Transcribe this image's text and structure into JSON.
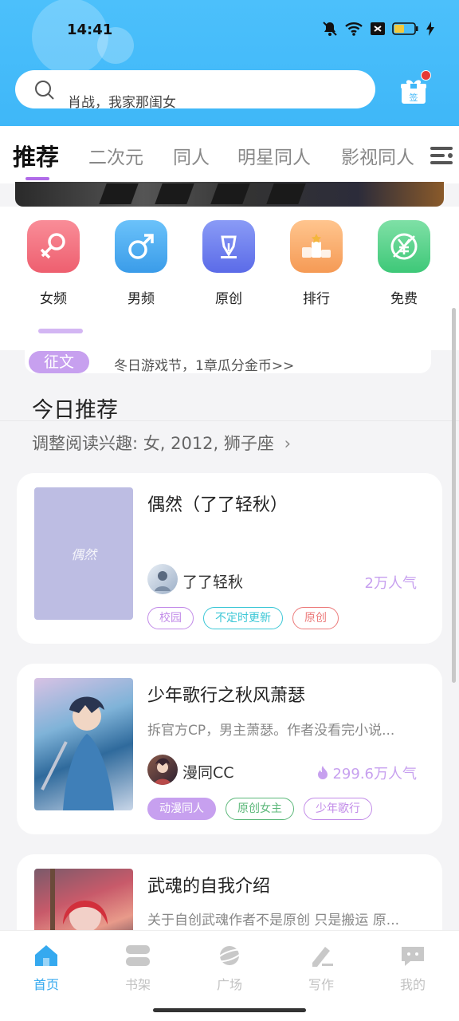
{
  "status_bar": {
    "time": "14:41"
  },
  "search": {
    "placeholder_text": "肖战，我家那闺女"
  },
  "gift": {
    "label": "签"
  },
  "tabs": [
    {
      "label": "推荐",
      "active": true
    },
    {
      "label": "二次元"
    },
    {
      "label": "同人"
    },
    {
      "label": "明星同人"
    },
    {
      "label": "影视同人"
    }
  ],
  "categories": [
    {
      "label": "女频",
      "icon": "female-icon",
      "color": "#f06a78"
    },
    {
      "label": "男频",
      "icon": "male-icon",
      "color": "#42a9f0"
    },
    {
      "label": "原创",
      "icon": "pen-nib-icon",
      "color": "#6b7ff0"
    },
    {
      "label": "排行",
      "icon": "ranking-icon",
      "color": "#f5a060"
    },
    {
      "label": "免费",
      "icon": "yuan-icon",
      "color": "#48cf7e"
    }
  ],
  "notice": {
    "tag": "征文",
    "text": "冬日游戏节，1章瓜分金币>>"
  },
  "section": {
    "title": "今日推荐",
    "subtitle": "调整阅读兴趣: 女, 2012, 狮子座"
  },
  "books": [
    {
      "title": "偶然（了了轻秋）",
      "cover_text": "偶然",
      "author": "了了轻秋",
      "popularity": "2万人气",
      "tags": [
        {
          "label": "校园",
          "color": "#c28be8"
        },
        {
          "label": "不定时更新",
          "color": "#3cc7d6"
        },
        {
          "label": "原创",
          "color": "#ec7b7b"
        }
      ]
    },
    {
      "title": "少年歌行之秋风萧瑟",
      "desc": "拆官方CP，男主萧瑟。作者没看完小说...",
      "author": "漫同CC",
      "popularity": "299.6万人气",
      "tags": [
        {
          "label": "动漫同人",
          "color": "#c28be8",
          "filled": true
        },
        {
          "label": "原创女主",
          "color": "#5cb87a"
        },
        {
          "label": "少年歌行",
          "color": "#c28be8"
        }
      ]
    },
    {
      "title": "武魂的自我介绍",
      "desc": "关于自创武魂作者不是原创 只是搬运 原..."
    }
  ],
  "bottom_nav": [
    {
      "label": "首页",
      "icon": "home-icon",
      "active": true
    },
    {
      "label": "书架",
      "icon": "bookshelf-icon"
    },
    {
      "label": "广场",
      "icon": "planet-icon"
    },
    {
      "label": "写作",
      "icon": "pencil-icon"
    },
    {
      "label": "我的",
      "icon": "chat-bubble-icon"
    }
  ]
}
